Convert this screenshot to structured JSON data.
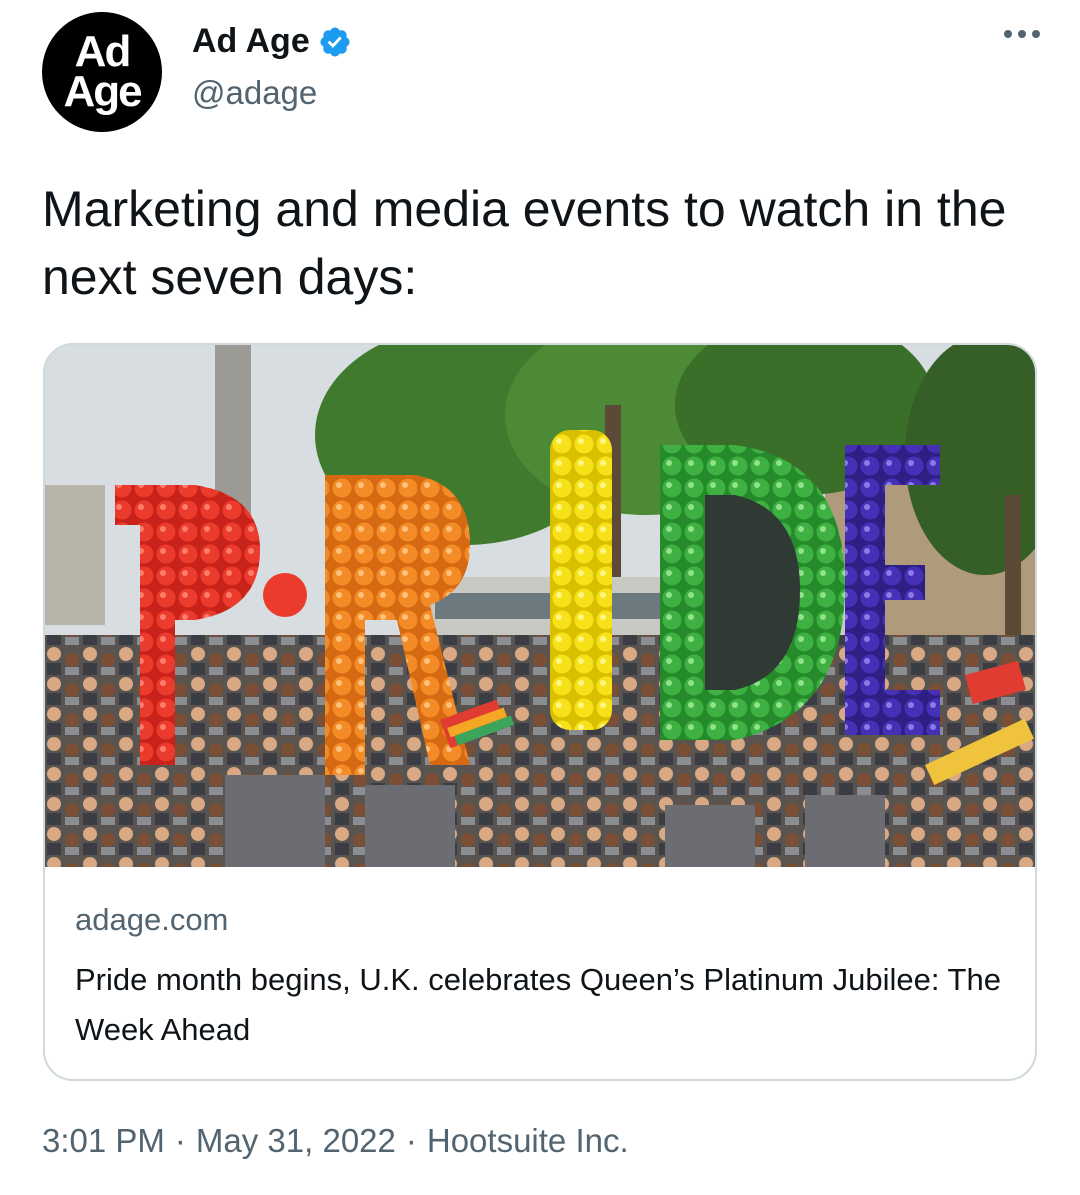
{
  "author": {
    "avatar_line1": "Ad",
    "avatar_line2": "Age",
    "display_name": "Ad Age",
    "handle": "@adage",
    "verified": true,
    "verified_color": "#1d9bf0"
  },
  "tweet": {
    "text": "Marketing and media events to watch in the next seven days:"
  },
  "card": {
    "image_alt": "Pride parade with balloon letters",
    "domain": "adage.com",
    "title": "Pride month begins, U.K. celebrates Queen’s Platinum Jubilee: The Week Ahead"
  },
  "meta": {
    "time": "3:01 PM",
    "separator": "·",
    "date": "May 31, 2022",
    "source": "Hootsuite Inc."
  },
  "icons": {
    "verified": "verified-badge-icon",
    "more": "more-options-icon"
  }
}
